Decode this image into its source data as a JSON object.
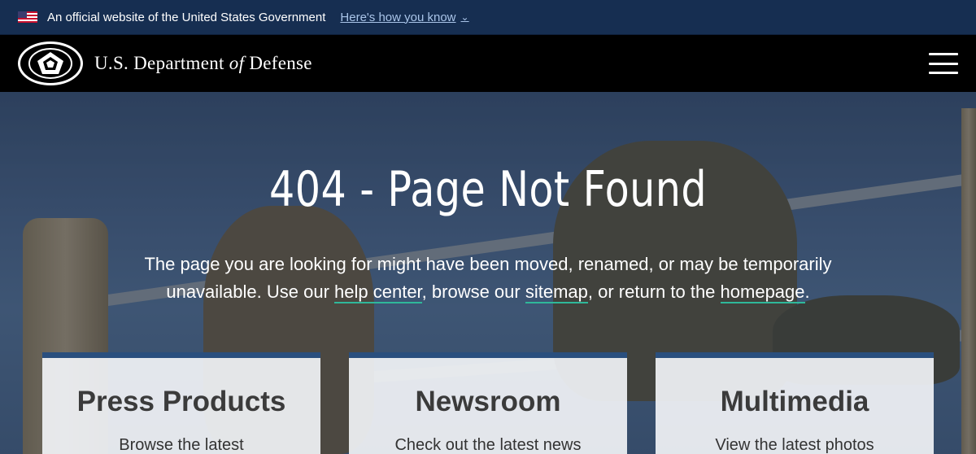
{
  "gov_banner": {
    "text": "An official website of the United States Government",
    "link": "Here's how you know"
  },
  "header": {
    "title_prefix": "U.S. Department ",
    "title_of": "of",
    "title_suffix": " Defense"
  },
  "hero": {
    "title": "404 - Page Not Found",
    "desc_part1": "The page you are looking for might have been moved, renamed, or may be temporarily unavailable. Use our ",
    "help_link": "help center",
    "desc_part2": ", browse our ",
    "sitemap_link": "sitemap",
    "desc_part3": ", or return to the ",
    "homepage_link": "homepage",
    "desc_part4": "."
  },
  "cards": [
    {
      "title": "Press Products",
      "text": "Browse the latest"
    },
    {
      "title": "Newsroom",
      "text": "Check out the latest news"
    },
    {
      "title": "Multimedia",
      "text": "View the latest photos"
    }
  ]
}
